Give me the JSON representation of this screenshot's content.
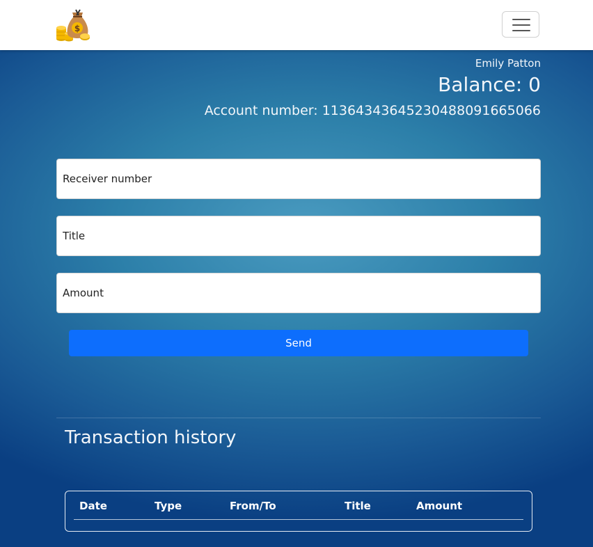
{
  "header": {
    "logo_icon": "money-bag-coins-icon",
    "menu_icon": "hamburger-menu-icon"
  },
  "account": {
    "user_name": "Emily Patton",
    "balance_text": "Balance: 0",
    "account_number_text": "Account number: 11364343645230488091665066"
  },
  "transfer_form": {
    "receiver_placeholder": "Receiver number",
    "title_placeholder": "Title",
    "amount_placeholder": "Amount",
    "send_label": "Send"
  },
  "history": {
    "title": "Transaction history",
    "columns": [
      "Date",
      "Type",
      "From/To",
      "Title",
      "Amount"
    ]
  },
  "colors": {
    "send_button": "#0d6efd",
    "navbar": "#ffffff"
  }
}
